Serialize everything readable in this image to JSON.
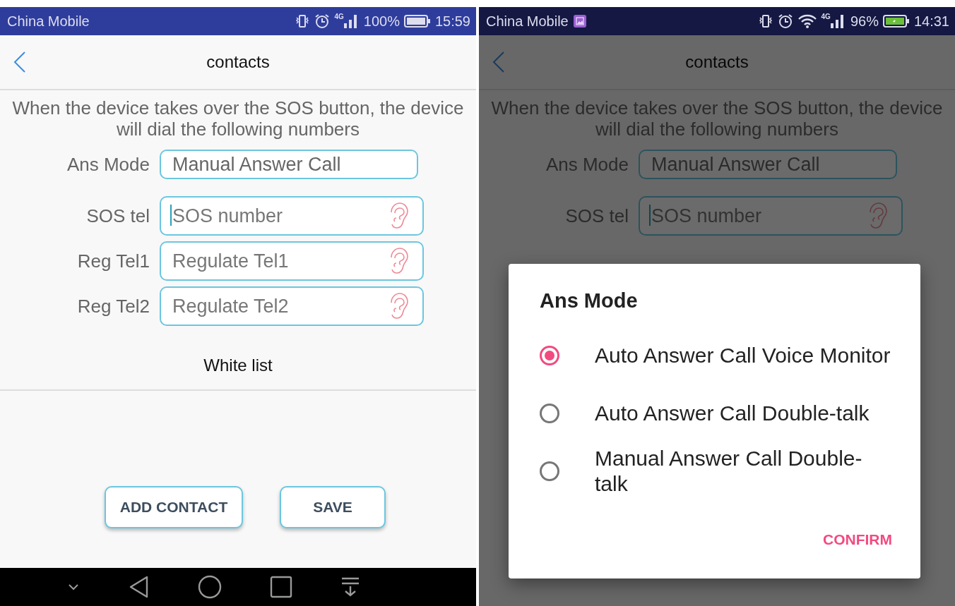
{
  "screens": [
    {
      "status_bar": {
        "carrier": "China Mobile",
        "image_notification": false,
        "wifi": false,
        "network": "4G",
        "battery_percent": "100%",
        "charging": false,
        "time": "15:59"
      },
      "header": {
        "title": "contacts"
      },
      "description": "When the device takes over the SOS button, the device will dial the following numbers",
      "fields": [
        {
          "label": "Ans Mode",
          "kind": "select",
          "value": "Manual Answer Call",
          "focused": false
        },
        {
          "label": "SOS tel",
          "kind": "number",
          "placeholder": "SOS number",
          "focused": true
        },
        {
          "label": "Reg Tel1",
          "kind": "number",
          "placeholder": "Regulate Tel1",
          "focused": false
        },
        {
          "label": "Reg Tel2",
          "kind": "number",
          "placeholder": "Regulate Tel2",
          "focused": false
        }
      ],
      "section_title": "White list",
      "buttons": [
        "ADD CONTACT",
        "SAVE"
      ],
      "nav_bar": true,
      "dimmed": false
    },
    {
      "status_bar": {
        "carrier": "China Mobile",
        "image_notification": true,
        "wifi": true,
        "network": "4G",
        "battery_percent": "96%",
        "charging": true,
        "time": "14:31"
      },
      "header": {
        "title": "contacts"
      },
      "description": "When the device takes over the SOS button, the device will dial the following numbers",
      "fields": [
        {
          "label": "Ans Mode",
          "kind": "select",
          "value": "Manual Answer Call",
          "focused": false
        },
        {
          "label": "SOS tel",
          "kind": "number",
          "placeholder": "SOS number",
          "focused": true
        }
      ],
      "nav_bar": false,
      "dimmed": true,
      "dialog": {
        "title": "Ans Mode",
        "options": [
          {
            "label": "Auto Answer Call Voice Monitor",
            "selected": true
          },
          {
            "label": "Auto Answer Call Double-talk",
            "selected": false
          },
          {
            "label": "Manual Answer Call Double-talk",
            "selected": false
          }
        ],
        "confirm": "CONFIRM"
      }
    }
  ]
}
